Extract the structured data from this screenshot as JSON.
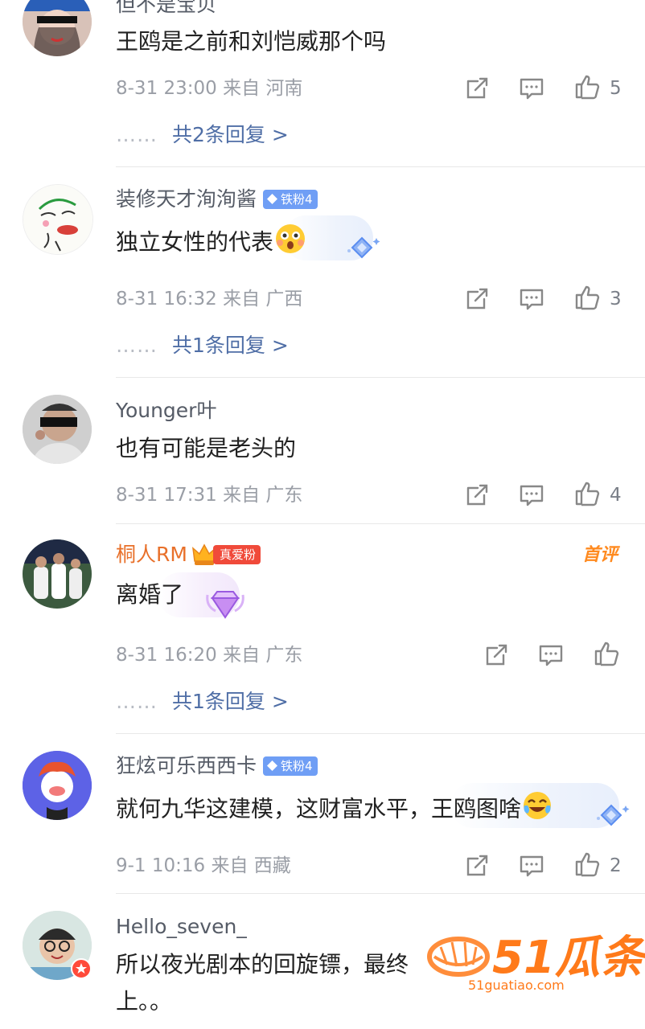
{
  "comments": [
    {
      "name": "但不是宝贝",
      "text": "王鸥是之前和刘恺威那个吗",
      "meta": "8-31 23:00 来自 河南",
      "likes": "5",
      "replies": "共2条回复 >"
    },
    {
      "name": "装修天才洵洵酱",
      "badge": "铁粉4",
      "text": "独立女性的代表",
      "meta": "8-31 16:32 来自 广西",
      "likes": "3",
      "replies": "共1条回复 >"
    },
    {
      "name": "Younger叶",
      "text": "也有可能是老头的",
      "meta": "8-31 17:31 来自 广东",
      "likes": "4"
    },
    {
      "name": "桐人RM",
      "badge": "真爱粉",
      "first_tag": "首评",
      "text": "离婚了",
      "meta": "8-31 16:20 来自 广东",
      "replies": "共1条回复 >"
    },
    {
      "name": "狂炫可乐西西卡",
      "badge": "铁粉4",
      "text": "就何九华这建模，这财富水平，王鸥图啥",
      "meta": "9-1 10:16 来自 西藏",
      "likes": "2"
    },
    {
      "name": "Hello_seven_",
      "text_line1": "所以夜光剧本的回旋镖，最终",
      "text_line2": "上。。"
    }
  ],
  "reply_dots": "……",
  "watermark": {
    "brand": "51瓜条",
    "url": "51guatiao.com"
  },
  "colors": {
    "link": "#4f6ea6",
    "vip_name": "#e8702a",
    "iron_badge": "#6f9ef5",
    "true_badge": "#f04a3a"
  }
}
